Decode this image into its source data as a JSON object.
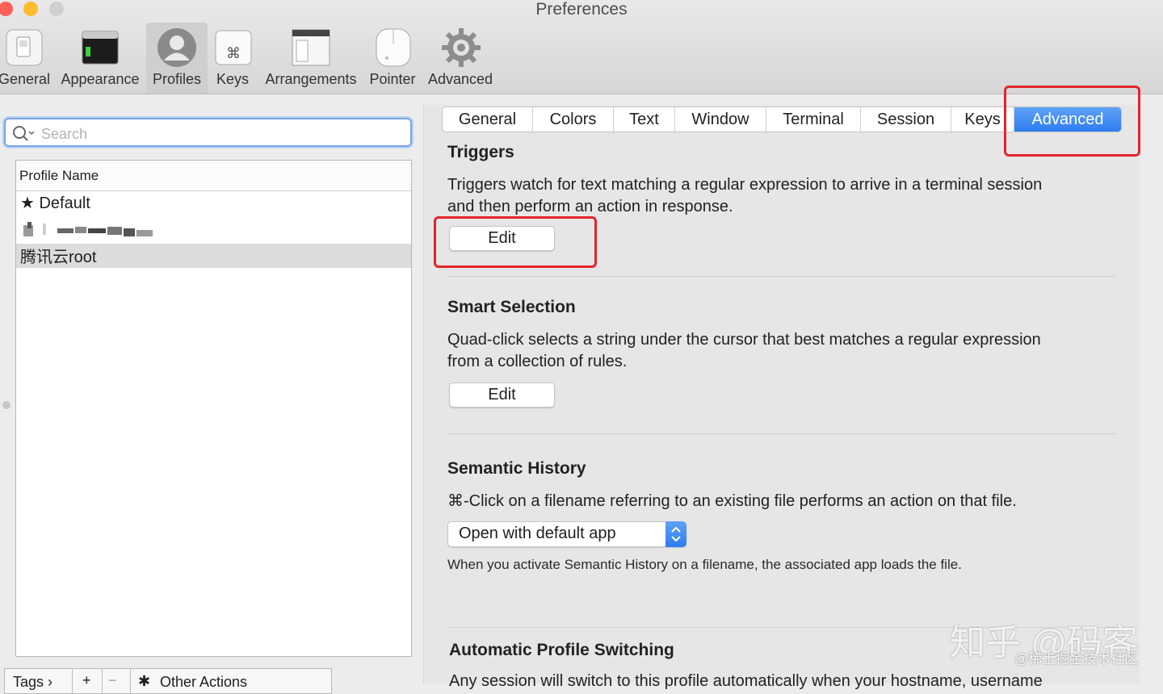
{
  "window": {
    "title": "Preferences"
  },
  "toolbar": {
    "items": [
      {
        "label": "General",
        "icon": "general-switch-icon"
      },
      {
        "label": "Appearance",
        "icon": "terminal-window-icon"
      },
      {
        "label": "Profiles",
        "icon": "user-silhouette-icon",
        "selected": true
      },
      {
        "label": "Keys",
        "icon": "command-key-icon"
      },
      {
        "label": "Arrangements",
        "icon": "window-arrangement-icon"
      },
      {
        "label": "Pointer",
        "icon": "mouse-icon"
      },
      {
        "label": "Advanced",
        "icon": "gear-icon"
      }
    ]
  },
  "sidebar": {
    "search_placeholder": "Search",
    "list_header": "Profile Name",
    "profiles": [
      {
        "label": "★ Default"
      },
      {
        "label": "",
        "redacted": true
      },
      {
        "label": "腾讯云root",
        "selected": true
      }
    ],
    "bottom_bar": {
      "tags_label": "Tags ›",
      "add_label": "+",
      "remove_label": "−",
      "other_actions_label": "Other Actions"
    }
  },
  "tabs": {
    "items": [
      "General",
      "Colors",
      "Text",
      "Window",
      "Terminal",
      "Session",
      "Keys",
      "Advanced"
    ],
    "selected": "Advanced"
  },
  "advanced": {
    "triggers": {
      "title": "Triggers",
      "description_line1": "Triggers watch for text matching a regular expression to arrive in a terminal session",
      "description_line2": "and then perform an action in response.",
      "button": "Edit"
    },
    "smart_selection": {
      "title": "Smart Selection",
      "description_line1": "Quad-click selects a string under the cursor that best matches a regular expression",
      "description_line2": "from a collection of rules.",
      "button": "Edit"
    },
    "semantic_history": {
      "title": "Semantic History",
      "description": "⌘-Click on a filename referring to an existing file performs an action on that file.",
      "selected_option": "Open with default app",
      "note": "When you activate Semantic History on a filename, the associated app loads the file."
    },
    "auto_profile_switching": {
      "title": "Automatic Profile Switching",
      "description": "Any session will switch to this profile automatically when your hostname, username"
    }
  },
  "watermark": {
    "main": "知乎 @码客",
    "sub": "@稀土掘金技术社区"
  },
  "colors": {
    "accent": "#2e7cf0",
    "highlight_box": "#e4242b",
    "close": "#fe5f57",
    "minimize": "#febc2e",
    "zoom": "#d0d0d0"
  }
}
